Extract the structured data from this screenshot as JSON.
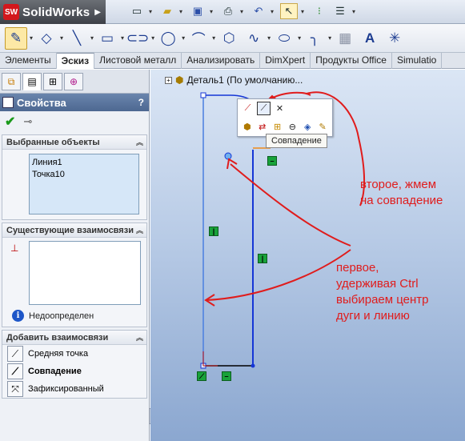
{
  "app": {
    "logo_mark": "SW",
    "title": "SolidWorks"
  },
  "toolbar_top": {
    "icons": [
      "new-icon",
      "open-icon",
      "save-icon",
      "print-icon",
      "undo-icon",
      "select-icon",
      "traffic-light-icon",
      "options-icon"
    ]
  },
  "sketch_toolbar": {
    "icons": [
      "sketch-icon",
      "smart-dimension-icon",
      "line-icon",
      "rectangle-icon",
      "slot-icon",
      "circle-icon",
      "arc-icon",
      "polygon-icon",
      "spline-icon",
      "ellipse-icon",
      "fillet-icon",
      "construction-icon",
      "text-icon",
      "point-icon"
    ]
  },
  "tabs": [
    {
      "label": "Элементы"
    },
    {
      "label": "Эскиз"
    },
    {
      "label": "Листовой металл"
    },
    {
      "label": "Анализировать"
    },
    {
      "label": "DimXpert"
    },
    {
      "label": "Продукты Office"
    },
    {
      "label": "Simulatio"
    }
  ],
  "property_manager": {
    "title": "Свойства",
    "help": "?",
    "selected": {
      "header": "Выбранные объекты",
      "items": [
        "Линия1",
        "Точка10"
      ]
    },
    "existing": {
      "header": "Существующие взаимосвязи",
      "status": "Недоопределен"
    },
    "add": {
      "header": "Добавить взаимосвязи",
      "items": [
        {
          "label": "Средняя точка",
          "icon": "midpoint-icon"
        },
        {
          "label": "Совпадение",
          "icon": "coincident-icon"
        },
        {
          "label": "Зафиксированный",
          "icon": "fix-icon"
        }
      ]
    }
  },
  "graphics": {
    "tree_label": "Деталь1  (По умолчанию...",
    "tooltip": "Совпадение",
    "annotation_1": [
      "второе, жмем",
      "на совпадение"
    ],
    "annotation_2": [
      "первое,",
      "удерживая Ctrl",
      "выбираем центр",
      "дуги и линию"
    ],
    "colors": {
      "annotation": "#e01c1c",
      "sketch_line": "#1536d6",
      "relation_badge": "#18a23a"
    }
  }
}
